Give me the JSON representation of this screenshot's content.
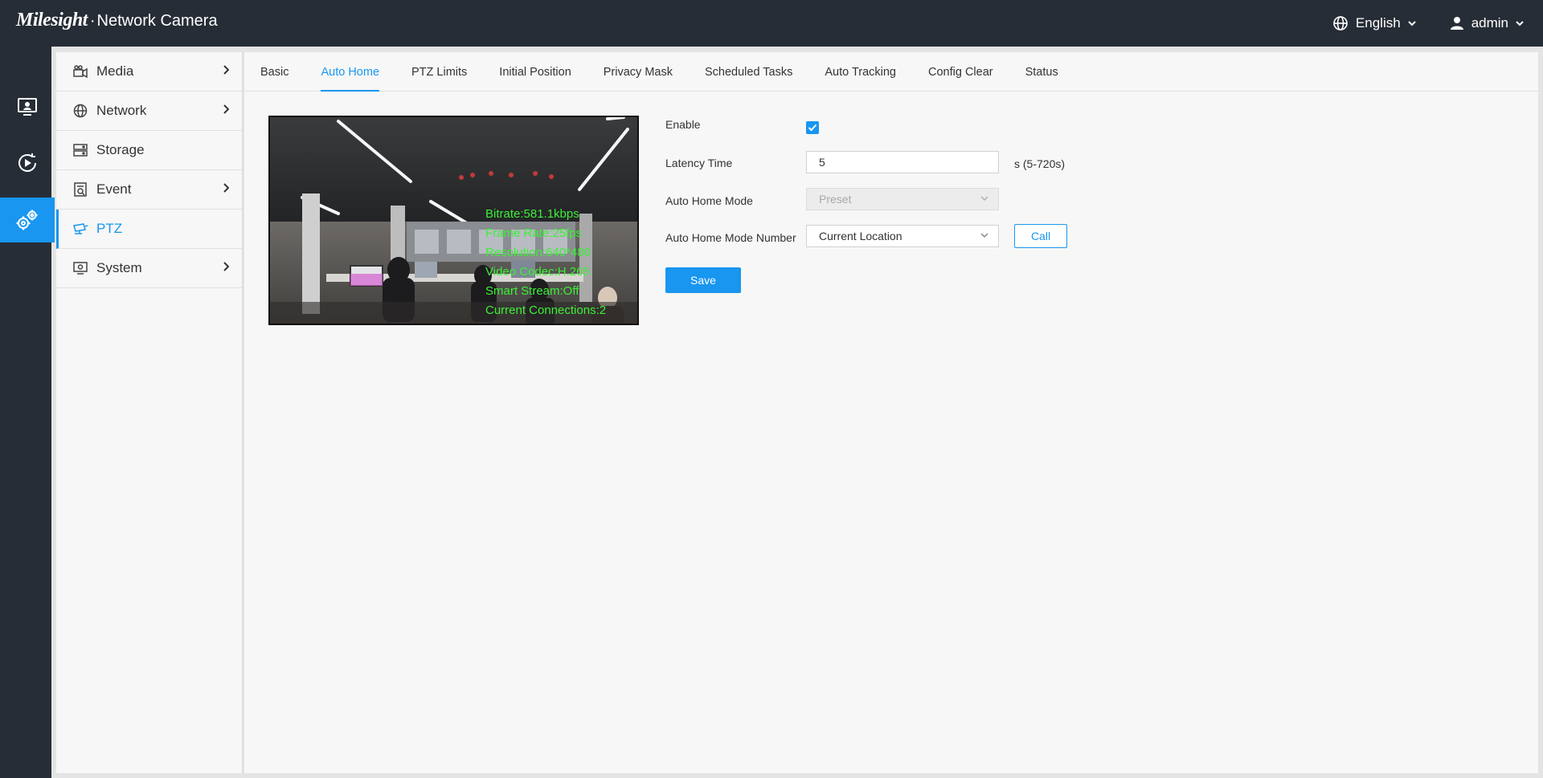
{
  "header": {
    "brand": "Milesight",
    "separator": "·",
    "product": "Network Camera",
    "language": "English",
    "user": "admin"
  },
  "rail": [
    {
      "name": "live-view-icon"
    },
    {
      "name": "playback-icon"
    },
    {
      "name": "settings-icon",
      "active": true
    }
  ],
  "sidebar": {
    "items": [
      {
        "label": "Media",
        "icon": "media-icon",
        "chevron": true
      },
      {
        "label": "Network",
        "icon": "globe-icon",
        "chevron": true
      },
      {
        "label": "Storage",
        "icon": "storage-icon",
        "chevron": false
      },
      {
        "label": "Event",
        "icon": "event-icon",
        "chevron": true
      },
      {
        "label": "PTZ",
        "icon": "ptz-camera-icon",
        "chevron": false,
        "active": true
      },
      {
        "label": "System",
        "icon": "system-icon",
        "chevron": true
      }
    ]
  },
  "tabs": [
    {
      "label": "Basic"
    },
    {
      "label": "Auto Home",
      "active": true
    },
    {
      "label": "PTZ Limits"
    },
    {
      "label": "Initial Position"
    },
    {
      "label": "Privacy Mask"
    },
    {
      "label": "Scheduled Tasks"
    },
    {
      "label": "Auto Tracking"
    },
    {
      "label": "Config Clear"
    },
    {
      "label": "Status"
    }
  ],
  "video": {
    "osd": [
      "Bitrate:581.1kbps",
      "Frame Rate:25fps",
      "Resolution:640*480",
      "Video Codec:H.265",
      "Smart Stream:Off",
      "Current Connections:2"
    ]
  },
  "form": {
    "enable": {
      "label": "Enable",
      "checked": true
    },
    "latency": {
      "label": "Latency Time",
      "value": "5",
      "hint": "s (5-720s)"
    },
    "mode": {
      "label": "Auto Home Mode",
      "value": "Preset",
      "disabled": true
    },
    "mode_number": {
      "label": "Auto Home Mode Number",
      "value": "Current Location",
      "button": "Call"
    },
    "save": "Save"
  },
  "colors": {
    "accent": "#1896f0",
    "topbar": "#272d36",
    "osd_text": "#3cf036"
  }
}
